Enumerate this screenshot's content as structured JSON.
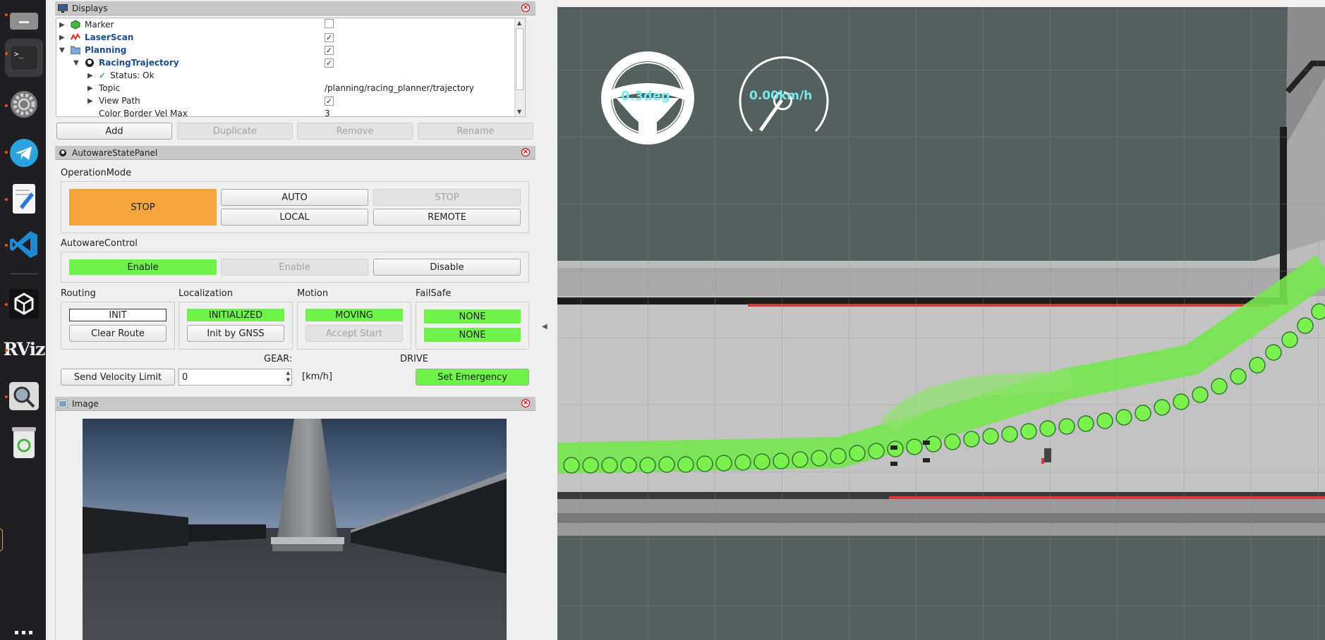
{
  "dock": {
    "items": [
      "files-icon",
      "terminal-icon",
      "settings-icon",
      "telegram-icon",
      "text-editor-icon",
      "vscode-icon",
      "unity-icon",
      "rviz-icon",
      "image-viewer-icon",
      "trash-icon",
      "apps-grid-icon"
    ],
    "rviz_label": "RViz"
  },
  "displays": {
    "title": "Displays",
    "rows": [
      {
        "name": "Marker",
        "value": ""
      },
      {
        "name": "LaserScan",
        "value": ""
      },
      {
        "name": "Planning",
        "value": ""
      },
      {
        "name": "RacingTrajectory",
        "value": ""
      },
      {
        "name": "Status: Ok",
        "value": ""
      },
      {
        "name": "Topic",
        "value": "/planning/racing_planner/trajectory"
      },
      {
        "name": "View Path",
        "value": ""
      },
      {
        "name": "Color Border Vel Max",
        "value": "3"
      }
    ],
    "buttons": {
      "add": "Add",
      "duplicate": "Duplicate",
      "remove": "Remove",
      "rename": "Rename"
    }
  },
  "autoware": {
    "title": "AutowareStatePanel",
    "operation_mode": {
      "label": "OperationMode",
      "state": "STOP",
      "auto": "AUTO",
      "stop": "STOP",
      "local": "LOCAL",
      "remote": "REMOTE"
    },
    "control": {
      "label": "AutowareControl",
      "state": "Enable",
      "enable": "Enable",
      "disable": "Disable"
    },
    "routing": {
      "label": "Routing",
      "state": "INIT",
      "clear": "Clear Route"
    },
    "localization": {
      "label": "Localization",
      "state": "INITIALIZED",
      "init": "Init by GNSS"
    },
    "motion": {
      "label": "Motion",
      "state": "MOVING",
      "accept": "Accept Start"
    },
    "failsafe": {
      "label": "FailSafe",
      "state1": "NONE",
      "state2": "NONE"
    },
    "gear_label": "GEAR:",
    "gear_value": "DRIVE",
    "velocity": {
      "button": "Send Velocity Limit",
      "value": "0",
      "unit": "[km/h]"
    },
    "emergency": "Set Emergency"
  },
  "image_panel": {
    "title": "Image"
  },
  "overlay": {
    "steering": "0.3deg",
    "speed": "0.00km/h"
  },
  "colors": {
    "accent_green": "#6ff24a",
    "stop_orange": "#f2a53a",
    "viewport_bg": "#53605e",
    "trajectory_green": "#77e64f"
  }
}
